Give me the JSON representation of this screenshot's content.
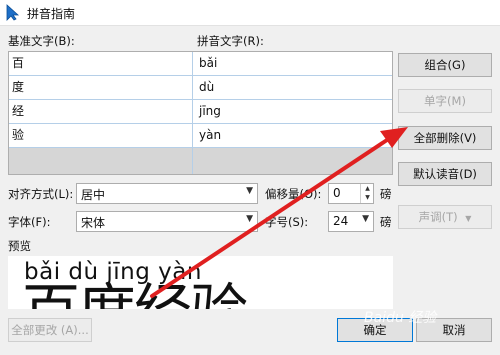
{
  "window": {
    "title": "拼音指南"
  },
  "labels": {
    "base_text": "基准文字(B):",
    "ruby_text": "拼音文字(R):",
    "alignment": "对齐方式(L):",
    "offset": "偏移量(O):",
    "offset_unit": "磅",
    "font": "字体(F):",
    "font_size": "字号(S):",
    "font_size_unit": "磅",
    "preview": "预览"
  },
  "rows": [
    {
      "base": "百",
      "ruby": "bǎi"
    },
    {
      "base": "度",
      "ruby": "dù"
    },
    {
      "base": "经",
      "ruby": "jīng"
    },
    {
      "base": "验",
      "ruby": "yàn"
    },
    {
      "base": "",
      "ruby": ""
    }
  ],
  "controls": {
    "alignment_value": "居中",
    "offset_value": "0",
    "font_value": "宋体",
    "font_size_value": "24"
  },
  "buttons": {
    "group": "组合(G)",
    "mono": "单字(M)",
    "clear_all": "全部删除(V)",
    "default_reading": "默认读音(D)",
    "tone": "声调(T)",
    "tone_arrow": "▼",
    "change_all": "全部更改 (A)...",
    "ok": "确定",
    "cancel": "取消"
  },
  "preview": {
    "pinyin": "bǎi  dù  jīng yàn",
    "hanzi": "百度经验"
  },
  "watermark": "Baidu 经验",
  "colors": {
    "annotation_arrow": "#e02020"
  }
}
